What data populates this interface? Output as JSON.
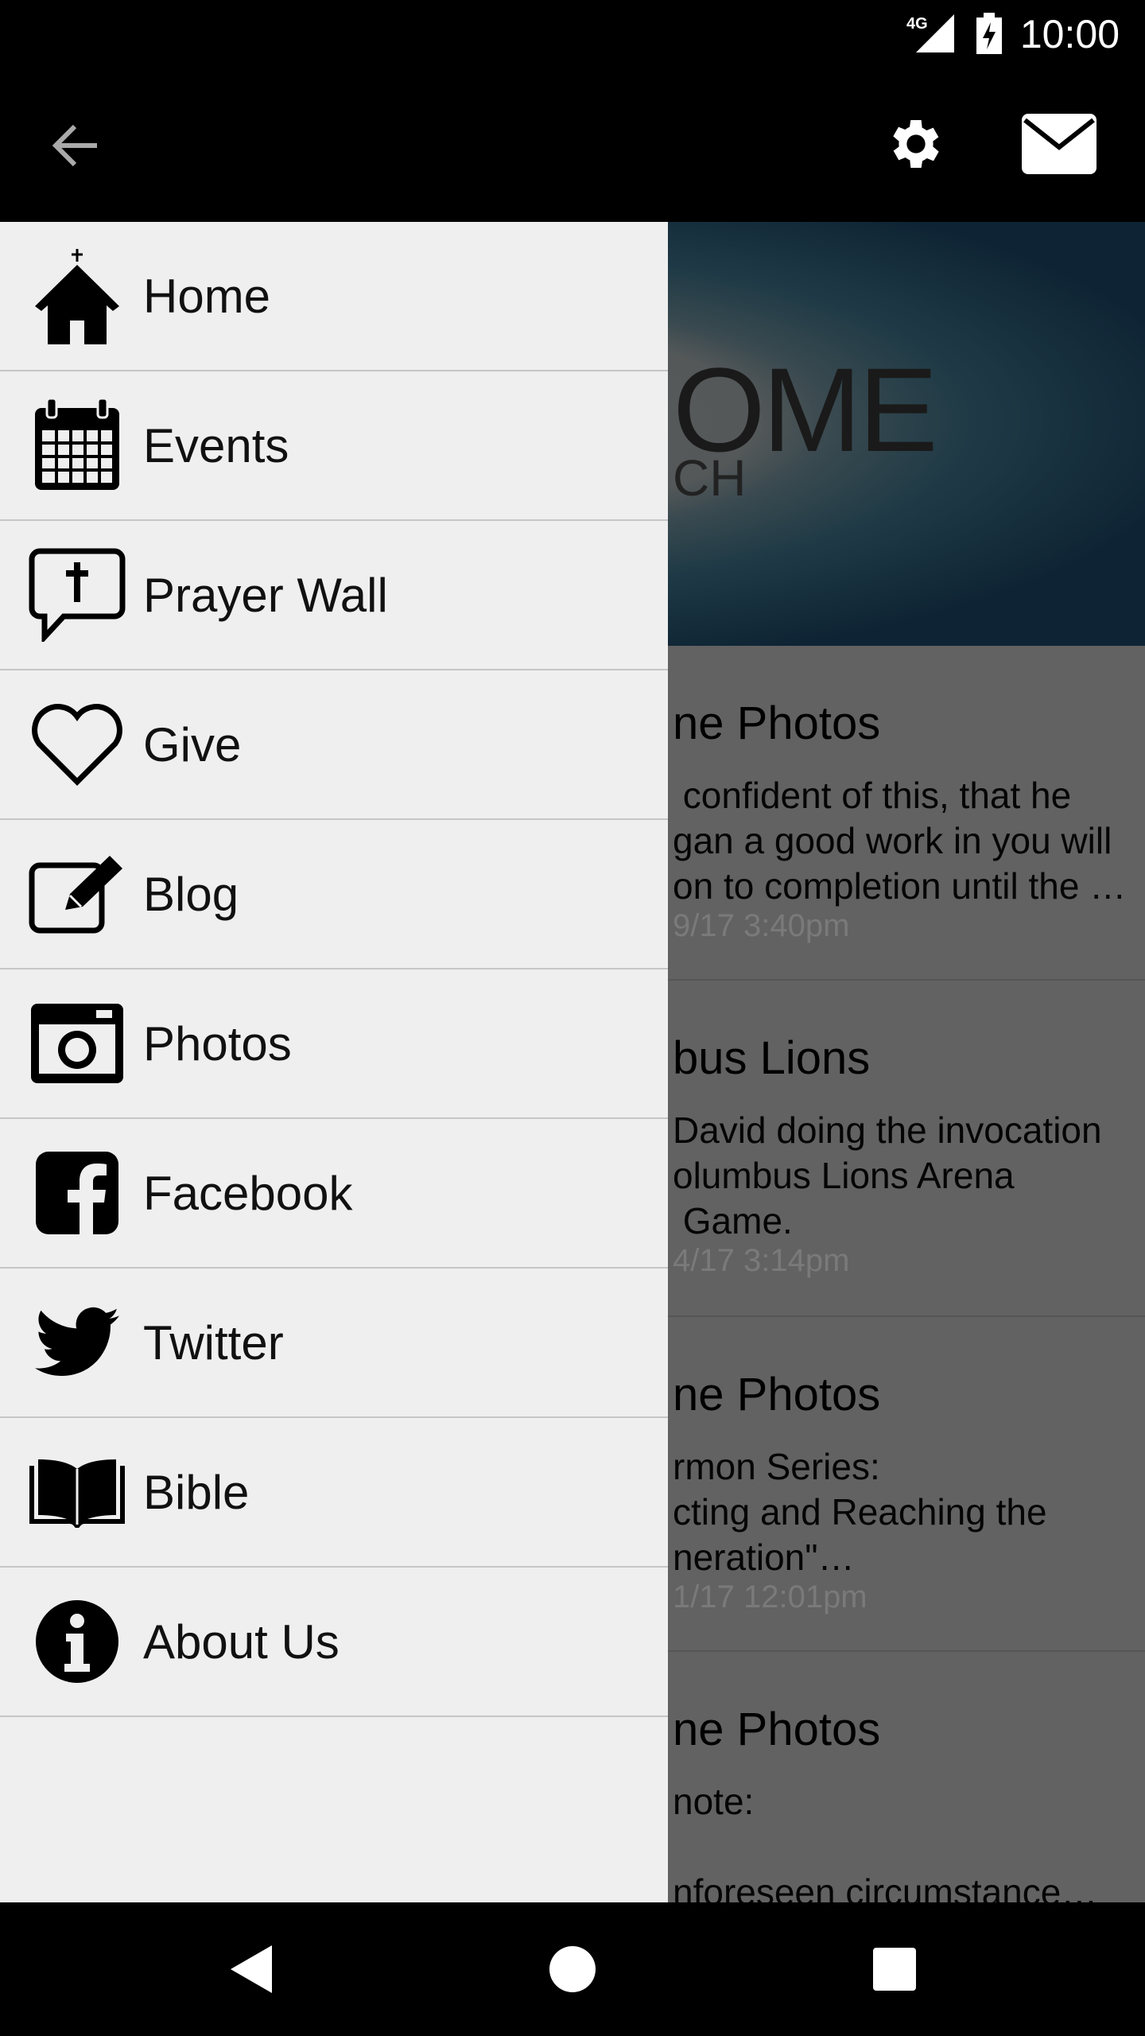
{
  "status_bar": {
    "network": "4G",
    "time": "10:00"
  },
  "toolbar": {
    "back_icon": "arrow-back-icon",
    "settings_icon": "gear-icon",
    "mail_icon": "envelope-icon"
  },
  "hero": {
    "title_fragment": "OME",
    "subtitle_fragment": "CH"
  },
  "feed": [
    {
      "title": "ne Photos",
      "body": " confident of this, that he\ngan a good work in you will\non to completion until the …",
      "date": "9/17 3:40pm"
    },
    {
      "title": "bus Lions",
      "body": "David doing the invocation\nolumbus Lions Arena\n Game.",
      "date": "4/17 3:14pm"
    },
    {
      "title": "ne Photos",
      "body": "rmon Series:\ncting and Reaching the\nneration\"…",
      "date": "1/17 12:01pm"
    },
    {
      "title": "ne Photos",
      "body": "note:\n\nnforeseen circumstance…",
      "date": ""
    }
  ],
  "drawer": {
    "items": [
      {
        "label": "Home",
        "icon": "church-home-icon"
      },
      {
        "label": "Events",
        "icon": "calendar-icon"
      },
      {
        "label": "Prayer Wall",
        "icon": "cross-speech-bubble-icon"
      },
      {
        "label": "Give",
        "icon": "heart-icon"
      },
      {
        "label": "Blog",
        "icon": "edit-pencil-icon"
      },
      {
        "label": "Photos",
        "icon": "camera-icon"
      },
      {
        "label": "Facebook",
        "icon": "facebook-icon"
      },
      {
        "label": "Twitter",
        "icon": "twitter-icon"
      },
      {
        "label": "Bible",
        "icon": "open-book-icon"
      },
      {
        "label": "About Us",
        "icon": "info-icon"
      }
    ]
  },
  "nav_bar": {
    "back": "nav-back-icon",
    "home": "nav-home-icon",
    "recents": "nav-recents-icon"
  }
}
